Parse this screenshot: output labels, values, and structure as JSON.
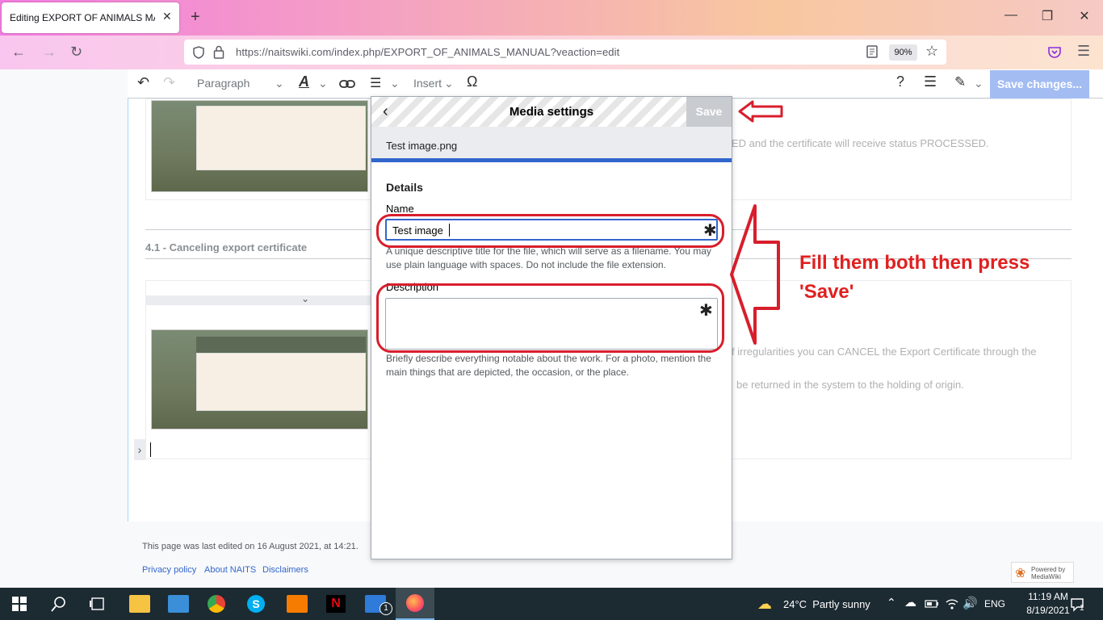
{
  "browser": {
    "tab_title": "Editing EXPORT OF ANIMALS MANUAL",
    "tab_close": "✕",
    "new_tab": "+",
    "url": "https://naitswiki.com/index.php/EXPORT_OF_ANIMALS_MANUAL?veaction=edit",
    "zoom": "90%"
  },
  "toolbar": {
    "paragraph": "Paragraph",
    "insert": "Insert",
    "help": "?",
    "save_changes": "Save changes..."
  },
  "page": {
    "processed_text": "ED and the certificate will receive status PROCESSED.",
    "heading": "4.1 - Canceling export certificate",
    "irregular_text": "f irregularities you can CANCEL the Export Certificate through the",
    "returned_text": "be returned in the system to the holding of origin.",
    "last_edited": "This page was last edited on 16 August 2021, at 14:21.",
    "footer_links": [
      "Privacy policy",
      "About NAITS",
      "Disclaimers"
    ],
    "powered_by": "Powered by MediaWiki"
  },
  "dialog": {
    "title": "Media settings",
    "save": "Save",
    "file_name": "Test image.png",
    "details_heading": "Details",
    "name_label": "Name",
    "name_value": "Test image",
    "name_help": "A unique descriptive title for the file, which will serve as a filename. You may use plain language with spaces. Do not include the file extension.",
    "description_label": "Description",
    "description_value": "",
    "description_help": "Briefly describe everything notable about the work. For a photo, mention the main things that are depicted, the occasion, or the place.",
    "required_mark": "✱"
  },
  "annotation": {
    "note": "Fill them both then press 'Save'",
    "color": "#d81e2c"
  },
  "taskbar": {
    "weather": "24°C  Partly sunny",
    "language": "ENG",
    "time": "11:19 AM",
    "date": "8/19/2021",
    "notification_count": "1"
  }
}
